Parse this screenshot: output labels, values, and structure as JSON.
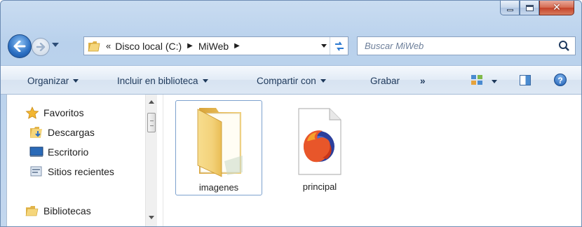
{
  "window": {
    "caption": {
      "minimize": "minimize",
      "maximize": "maximize",
      "close": "close"
    }
  },
  "address": {
    "overflow": "«",
    "crumbs": [
      "Disco local (C:)",
      "MiWeb"
    ]
  },
  "search": {
    "placeholder": "Buscar MiWeb"
  },
  "commands": {
    "organize": "Organizar",
    "include": "Incluir en biblioteca",
    "share": "Compartir con",
    "burn": "Grabar",
    "more": "»"
  },
  "nav_pane": {
    "favorites": "Favoritos",
    "downloads": "Descargas",
    "desktop": "Escritorio",
    "recent": "Sitios recientes",
    "libraries": "Bibliotecas"
  },
  "files": [
    {
      "name": "imagenes",
      "type": "folder",
      "selected": true
    },
    {
      "name": "principal",
      "type": "firefox-html"
    }
  ]
}
